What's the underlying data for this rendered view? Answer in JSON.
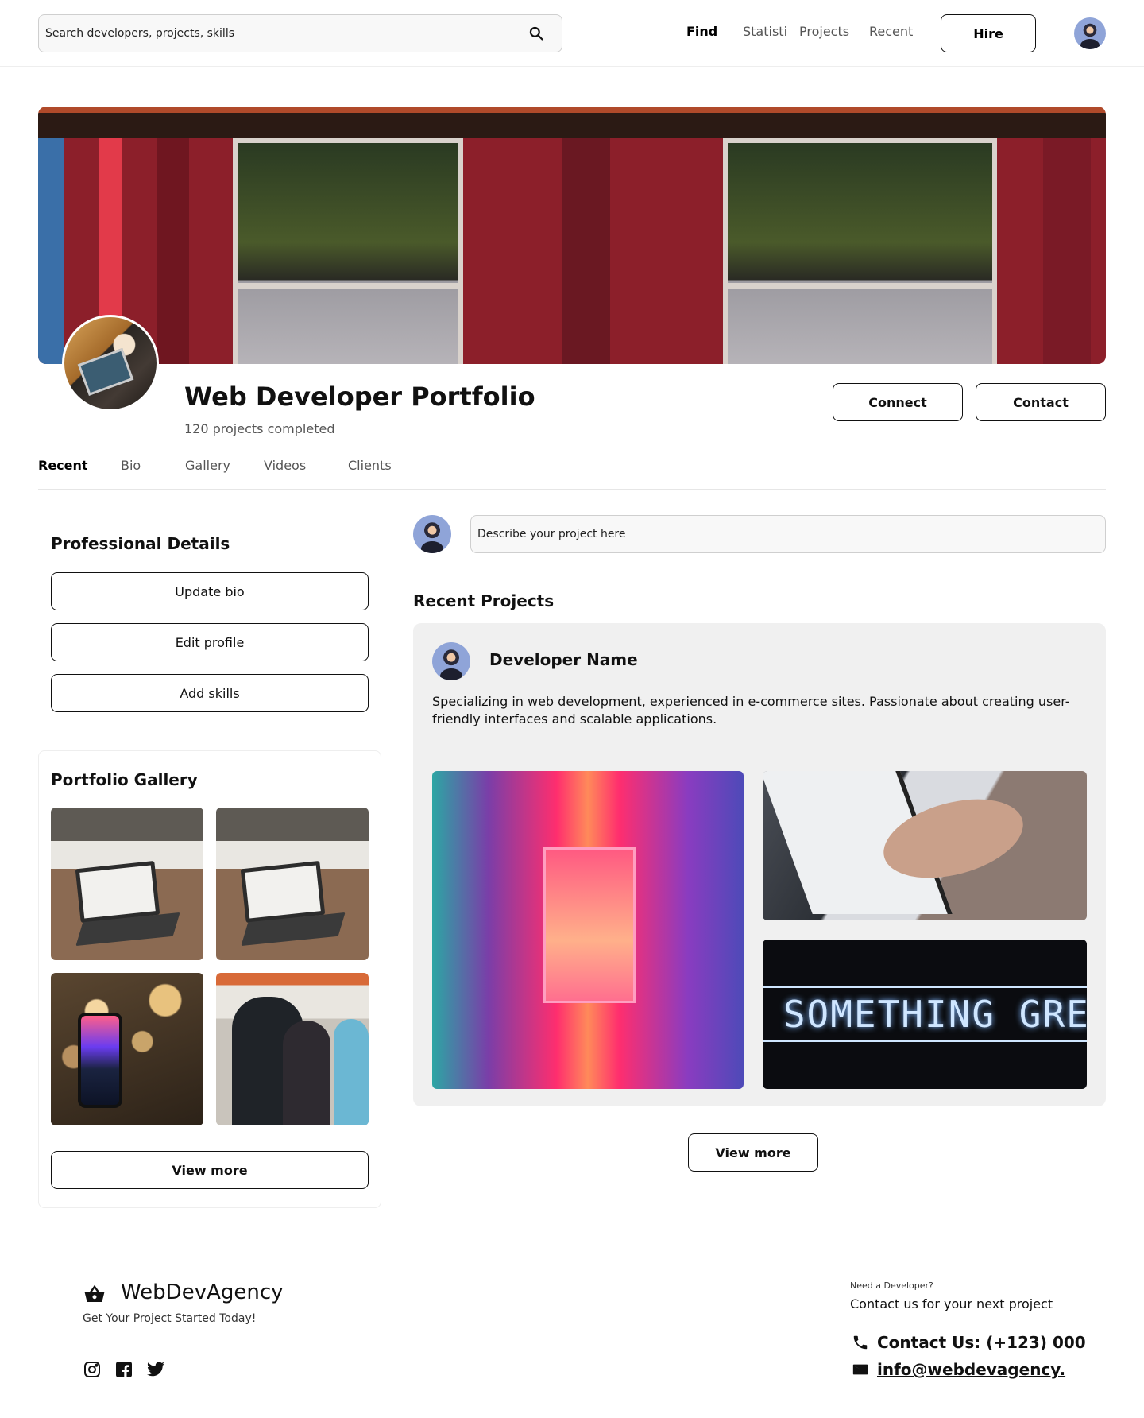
{
  "header": {
    "search_placeholder": "Search developers, projects, skills",
    "nav": [
      "Find",
      "Statisti",
      "Projects",
      "Recent"
    ],
    "hire_label": "Hire"
  },
  "profile": {
    "title": "Web Developer Portfolio",
    "subtitle": "120 projects completed",
    "connect_label": "Connect",
    "contact_label": "Contact"
  },
  "tabs": [
    "Recent",
    "Bio",
    "Gallery",
    "Videos",
    "Clients"
  ],
  "professional": {
    "heading": "Professional Details",
    "buttons": [
      "Update bio",
      "Edit profile",
      "Add skills"
    ]
  },
  "gallery": {
    "heading": "Portfolio Gallery",
    "view_more": "View more"
  },
  "post": {
    "placeholder": "Describe your project here"
  },
  "recent_projects": {
    "heading": "Recent Projects",
    "developer_name": "Developer Name",
    "description": "Specializing in web development, experienced in e-commerce sites. Passionate about creating user-friendly interfaces and scalable applications.",
    "neon_sign_text": "DO SOMETHING GREAT",
    "view_more": "View more"
  },
  "footer": {
    "brand": "WebDevAgency",
    "tagline": "Get Your Project Started Today!",
    "need_label": "Need a Developer?",
    "cta": "Contact us for your next project",
    "phone": "Contact Us: (+123) 000",
    "email": "info@webdevagency."
  },
  "icons": [
    "search-icon",
    "basket-icon",
    "instagram-icon",
    "facebook-icon",
    "twitter-icon",
    "phone-icon",
    "mail-icon"
  ]
}
